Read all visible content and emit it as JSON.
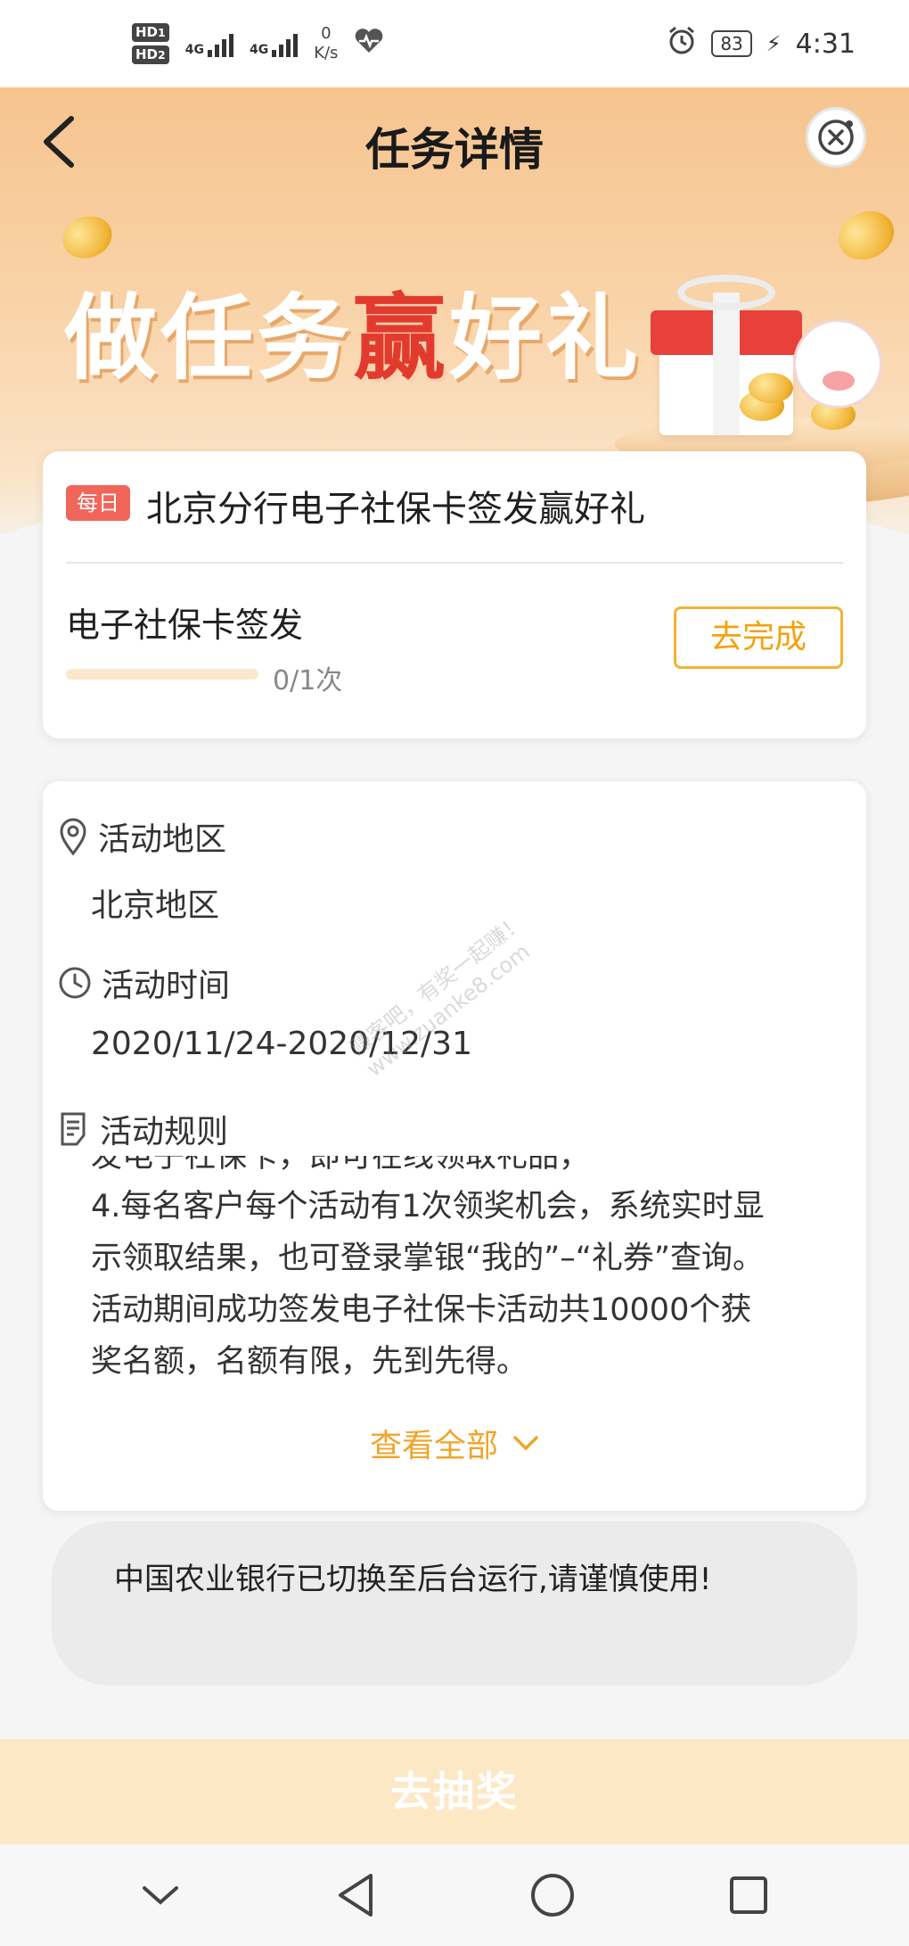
{
  "status_bar": {
    "hd1": "HD",
    "hd1_sub": "1",
    "hd2": "HD",
    "hd2_sub": "2",
    "net1": "4G",
    "net2": "4G",
    "speed_value": "0",
    "speed_unit": "K/s",
    "battery": "83",
    "time": "4:31",
    "icons": [
      "alarm-icon",
      "heart-rate-icon",
      "charging-icon"
    ]
  },
  "header": {
    "title": "任务详情",
    "back_icon": "back-arrow-icon",
    "close_icon": "close-circle-icon"
  },
  "banner": {
    "slogan_part1": "做任务",
    "slogan_highlight": "赢",
    "slogan_part2": "好礼",
    "colors": {
      "banner": "#f6c48f",
      "highlight": "#e23b2e"
    }
  },
  "task": {
    "badge": "每日",
    "title": "北京分行电子社保卡签发赢好礼",
    "name": "电子社保卡签发",
    "progress_text": "0/1次",
    "progress_fraction": 0.0,
    "action_label": "去完成"
  },
  "activity": {
    "region_label": "活动地区",
    "region_value": "北京地区",
    "time_label": "活动时间",
    "time_value": "2020/11/24-2020/12/31",
    "rules_label": "活动规则",
    "rules_clipped_line": "发电子社保卡，即可在线领取礼品，",
    "rules_lines": [
      "4.每名客户每个活动有1次领奖机会，系统实时显",
      "示领取结果，也可登录掌银“我的”–“礼券”查询。",
      "活动期间成功签发电子社保卡活动共10000个获",
      "奖名额，名额有限，先到先得。"
    ],
    "view_all_label": "查看全部"
  },
  "watermark": {
    "line1": "赚客吧，有奖一起赚！",
    "line2": "www.zuanke8.com"
  },
  "toast": {
    "message": "中国农业银行已切换至后台运行,请谨慎使用!"
  },
  "bottom": {
    "cta_label": "去抽奖",
    "cta_color": "#fde8c6"
  },
  "nav": {
    "icons": [
      "chevron-down-icon",
      "back-triangle-icon",
      "home-circle-icon",
      "recents-square-icon"
    ]
  }
}
